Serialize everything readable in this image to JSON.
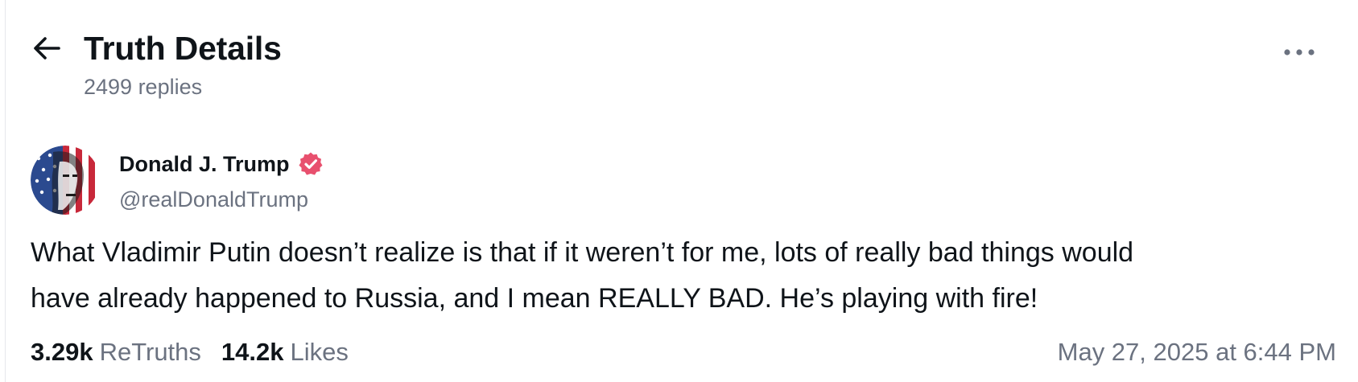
{
  "header": {
    "back_icon": "arrow-left-icon",
    "title": "Truth Details",
    "replies": "2499 replies",
    "more_icon": "more-horizontal-icon"
  },
  "post": {
    "author": {
      "display_name": "Donald J. Trump",
      "handle": "@realDonaldTrump",
      "verified_icon": "verified-badge-icon",
      "verified_color": "#e8506e"
    },
    "text_line1": "What Vladimir Putin doesn’t realize is that if it weren’t for me, lots of really bad things would",
    "text_line2": "have already happened to Russia, and I mean REALLY BAD. He’s playing with fire!",
    "stats": {
      "retruths_count": "3.29k",
      "retruths_label": "ReTruths",
      "likes_count": "14.2k",
      "likes_label": "Likes"
    },
    "timestamp": "May 27, 2025 at 6:44 PM"
  },
  "colors": {
    "text_primary": "#0f1419",
    "text_secondary": "#6b7280",
    "badge": "#e8506e"
  }
}
